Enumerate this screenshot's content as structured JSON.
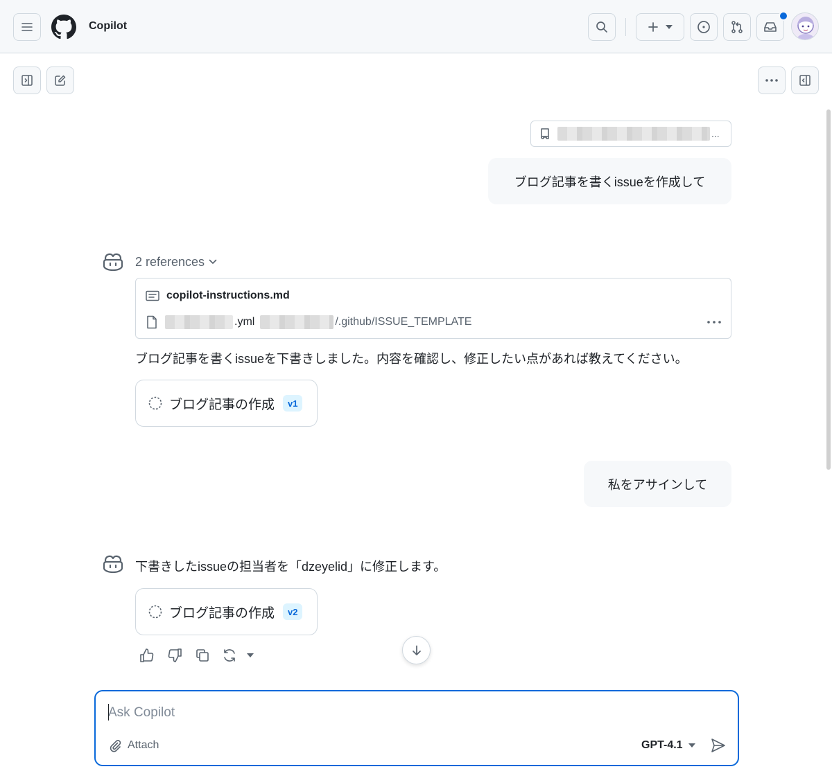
{
  "header": {
    "title": "Copilot"
  },
  "user_messages": [
    {
      "text": "ブログ記事を書くissueを作成して"
    },
    {
      "text": "私をアサインして"
    }
  ],
  "repo_chip": {
    "suffix": "..."
  },
  "references": {
    "toggle_label": "2 references",
    "items": [
      {
        "name": "copilot-instructions.md"
      },
      {
        "name_suffix": ".yml",
        "path": "/.github/ISSUE_TEMPLATE"
      }
    ]
  },
  "assistant_messages": [
    {
      "text": "ブログ記事を書くissueを下書きしました。内容を確認し、修正したい点があれば教えてください。",
      "issue": {
        "title": "ブログ記事の作成",
        "version": "v1"
      }
    },
    {
      "text": "下書きしたissueの担当者を「dzeyelid」に修正します。",
      "issue": {
        "title": "ブログ記事の作成",
        "version": "v2"
      }
    }
  ],
  "composer": {
    "placeholder": "Ask Copilot",
    "attach_label": "Attach",
    "model_label": "GPT-4.1"
  },
  "colors": {
    "accent": "#0969da",
    "badge_bg": "#ddf4ff",
    "border": "#d1d9e0",
    "header_bg": "#f6f8fa",
    "muted": "#59636e"
  }
}
